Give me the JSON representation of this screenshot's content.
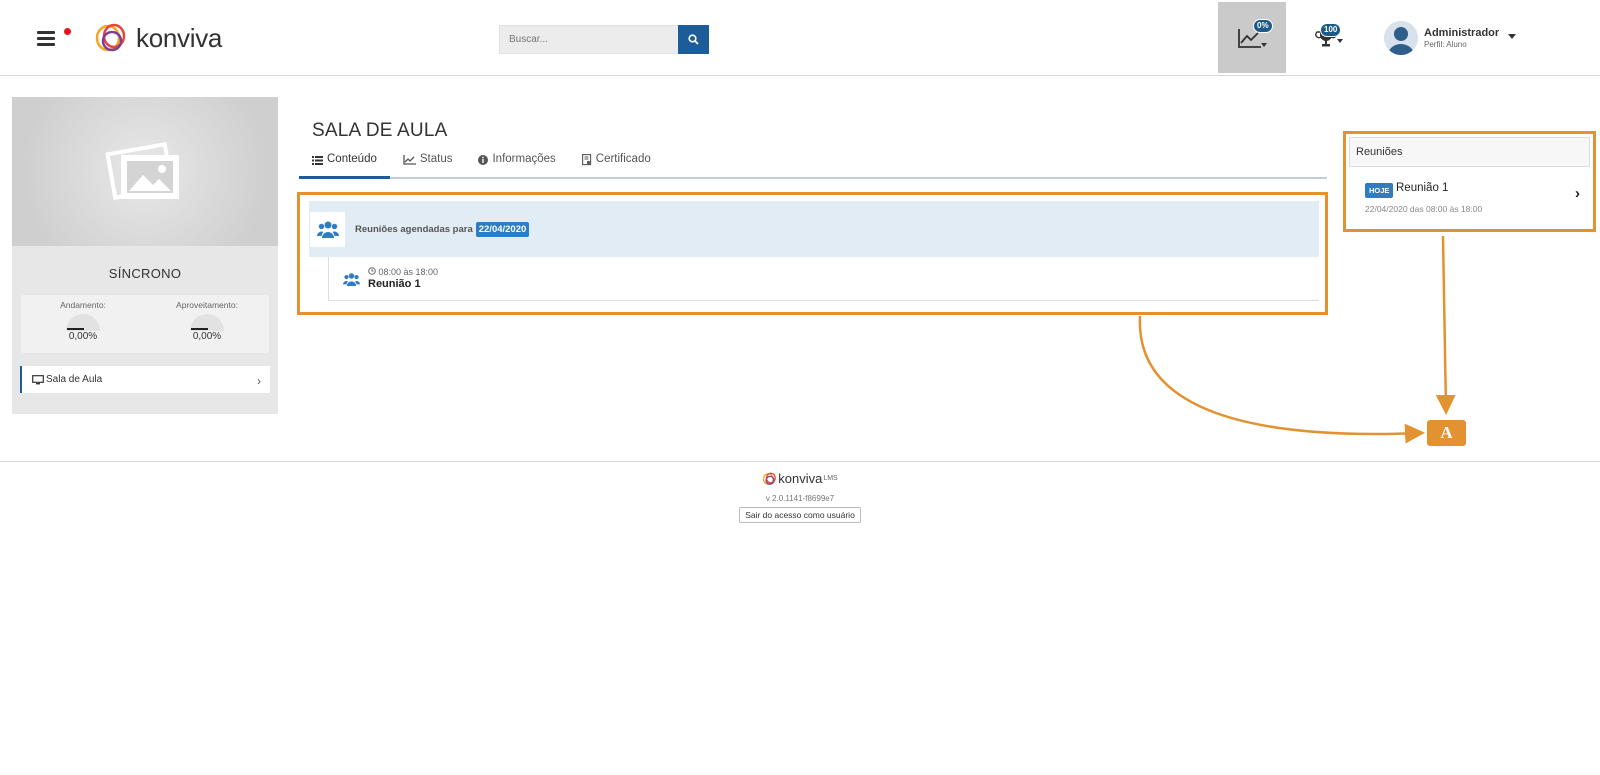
{
  "header": {
    "logo_text": "konviva",
    "search_placeholder": "Buscar...",
    "stats_badge": "0%",
    "trophy_badge": "100",
    "user_name": "Administrador",
    "user_role": "Perfil: Aluno"
  },
  "sidebar": {
    "course_title": "SÍNCRONO",
    "progress_label": "Andamento:",
    "progress_value": "0,00%",
    "score_label": "Aproveitamento:",
    "score_value": "0,00%",
    "link_label": "Sala de Aula"
  },
  "main": {
    "title": "SALA DE AULA",
    "tabs": [
      {
        "label": "Conteúdo",
        "icon": "list-icon"
      },
      {
        "label": "Status",
        "icon": "chart-icon"
      },
      {
        "label": "Informações",
        "icon": "info-icon"
      },
      {
        "label": "Certificado",
        "icon": "certificate-icon"
      }
    ],
    "meetings_header": "Reuniões agendadas para",
    "meetings_date": "22/04/2020",
    "meeting_time": "08:00 às 18:00",
    "meeting_name": "Reunião 1"
  },
  "side": {
    "title": "Reuniões",
    "tag": "HOJE",
    "meeting_name": "Reunião 1",
    "meeting_date": "22/04/2020 das 08:00 às 18:00"
  },
  "footer": {
    "logo_text": "konviva",
    "logo_sup": "LMS",
    "version": "v 2.0.1141-f8699e7",
    "exit_button": "Sair do acesso como usuário"
  },
  "annotation": {
    "label": "A"
  },
  "colors": {
    "accent": "#1c5d99",
    "highlight": "#e39232",
    "tag_blue": "#2e7cc3"
  }
}
